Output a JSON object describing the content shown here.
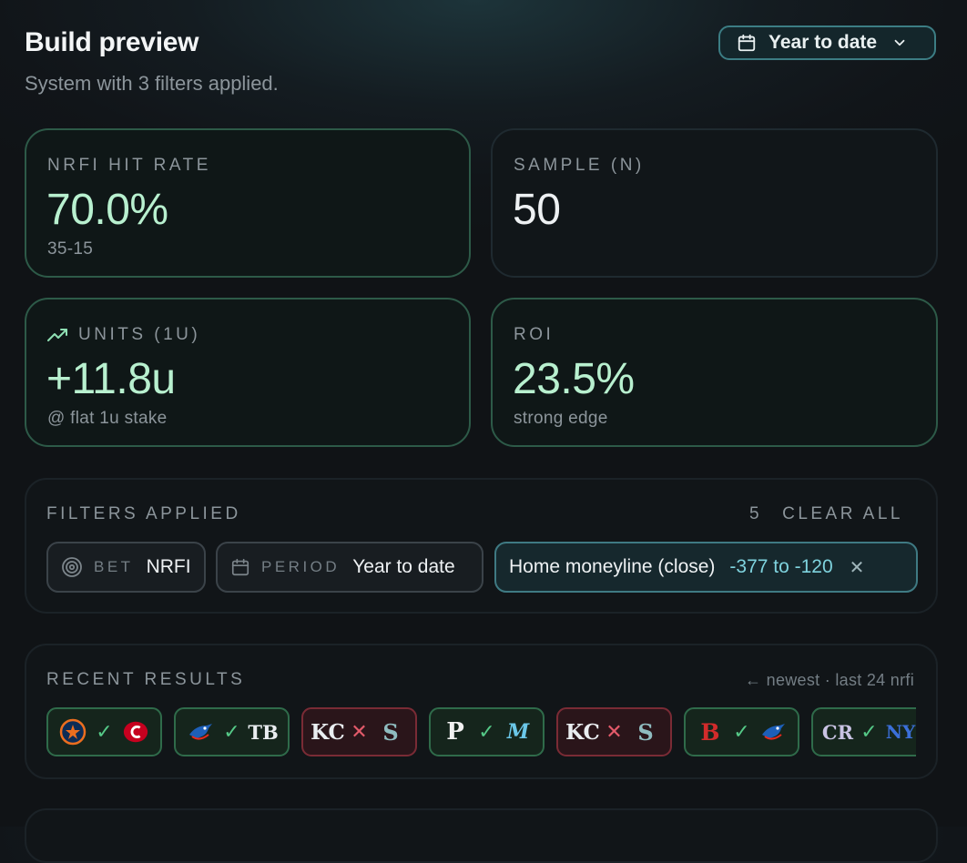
{
  "header": {
    "title": "Build preview",
    "subtitle": "System with 3 filters applied.",
    "range_selector": {
      "label": "Year to date",
      "icon": "calendar-icon"
    }
  },
  "stats": {
    "hit_rate": {
      "label": "NRFI HIT RATE",
      "value": "70.0%",
      "sub": "35-15"
    },
    "sample": {
      "label": "SAMPLE (N)",
      "value": "50"
    },
    "units": {
      "label": "UNITS (1U)",
      "value": "+11.8u",
      "sub": "@ flat 1u stake",
      "icon": "trending-up-icon"
    },
    "roi": {
      "label": "ROI",
      "value": "23.5%",
      "sub": "strong edge"
    }
  },
  "filters": {
    "label": "FILTERS APPLIED",
    "count": "5",
    "clear_label": "CLEAR ALL",
    "chips": [
      {
        "key": "BET",
        "value": "NRFI",
        "icon": "target-icon"
      },
      {
        "key": "PERIOD",
        "value": "Year to date",
        "icon": "calendar-icon"
      },
      {
        "name": "Home moneyline (close)",
        "range": "-377 to -120",
        "remove": "✕"
      }
    ]
  },
  "recent": {
    "label": "RECENT RESULTS",
    "hint": "← newest · last 24 nrfi",
    "games": [
      {
        "away": "HOU",
        "home": "CIN",
        "result": "win",
        "mark": "✓"
      },
      {
        "away": "TOR",
        "home": "TB",
        "result": "win",
        "mark": "✓"
      },
      {
        "away": "KC",
        "home": "SEA",
        "result": "loss",
        "mark": "✕"
      },
      {
        "away": "PHI",
        "home": "MIA",
        "result": "win",
        "mark": "✓"
      },
      {
        "away": "KC",
        "home": "SEA",
        "result": "loss",
        "mark": "✕"
      },
      {
        "away": "BOS",
        "home": "TOR",
        "result": "win",
        "mark": "✓"
      },
      {
        "away": "COL",
        "home": "NYM",
        "result": "win",
        "mark": "✓"
      }
    ]
  },
  "colors": {
    "accent_green": "#b8f0cf",
    "win": "#55c987",
    "loss": "#e35a6a",
    "accent_teal": "#7fd3de"
  }
}
